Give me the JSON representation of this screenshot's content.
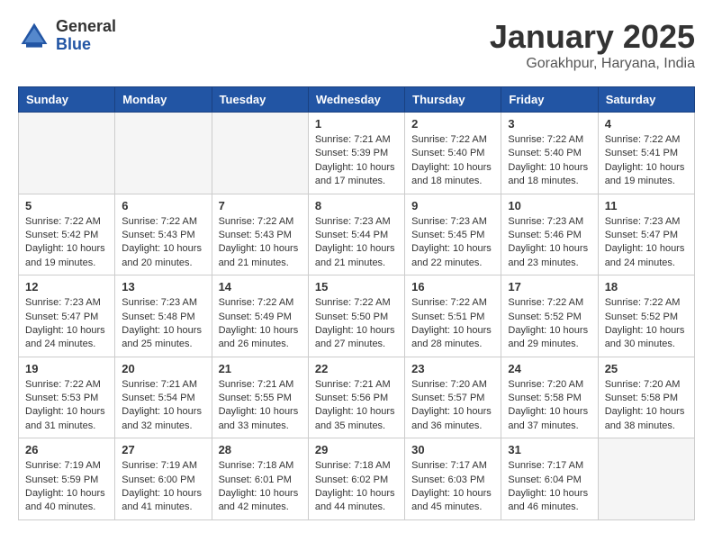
{
  "header": {
    "logo_general": "General",
    "logo_blue": "Blue",
    "title": "January 2025",
    "location": "Gorakhpur, Haryana, India"
  },
  "calendar": {
    "days_of_week": [
      "Sunday",
      "Monday",
      "Tuesday",
      "Wednesday",
      "Thursday",
      "Friday",
      "Saturday"
    ],
    "weeks": [
      [
        {
          "day": "",
          "info": ""
        },
        {
          "day": "",
          "info": ""
        },
        {
          "day": "",
          "info": ""
        },
        {
          "day": "1",
          "info": "Sunrise: 7:21 AM\nSunset: 5:39 PM\nDaylight: 10 hours\nand 17 minutes."
        },
        {
          "day": "2",
          "info": "Sunrise: 7:22 AM\nSunset: 5:40 PM\nDaylight: 10 hours\nand 18 minutes."
        },
        {
          "day": "3",
          "info": "Sunrise: 7:22 AM\nSunset: 5:40 PM\nDaylight: 10 hours\nand 18 minutes."
        },
        {
          "day": "4",
          "info": "Sunrise: 7:22 AM\nSunset: 5:41 PM\nDaylight: 10 hours\nand 19 minutes."
        }
      ],
      [
        {
          "day": "5",
          "info": "Sunrise: 7:22 AM\nSunset: 5:42 PM\nDaylight: 10 hours\nand 19 minutes."
        },
        {
          "day": "6",
          "info": "Sunrise: 7:22 AM\nSunset: 5:43 PM\nDaylight: 10 hours\nand 20 minutes."
        },
        {
          "day": "7",
          "info": "Sunrise: 7:22 AM\nSunset: 5:43 PM\nDaylight: 10 hours\nand 21 minutes."
        },
        {
          "day": "8",
          "info": "Sunrise: 7:23 AM\nSunset: 5:44 PM\nDaylight: 10 hours\nand 21 minutes."
        },
        {
          "day": "9",
          "info": "Sunrise: 7:23 AM\nSunset: 5:45 PM\nDaylight: 10 hours\nand 22 minutes."
        },
        {
          "day": "10",
          "info": "Sunrise: 7:23 AM\nSunset: 5:46 PM\nDaylight: 10 hours\nand 23 minutes."
        },
        {
          "day": "11",
          "info": "Sunrise: 7:23 AM\nSunset: 5:47 PM\nDaylight: 10 hours\nand 24 minutes."
        }
      ],
      [
        {
          "day": "12",
          "info": "Sunrise: 7:23 AM\nSunset: 5:47 PM\nDaylight: 10 hours\nand 24 minutes."
        },
        {
          "day": "13",
          "info": "Sunrise: 7:23 AM\nSunset: 5:48 PM\nDaylight: 10 hours\nand 25 minutes."
        },
        {
          "day": "14",
          "info": "Sunrise: 7:22 AM\nSunset: 5:49 PM\nDaylight: 10 hours\nand 26 minutes."
        },
        {
          "day": "15",
          "info": "Sunrise: 7:22 AM\nSunset: 5:50 PM\nDaylight: 10 hours\nand 27 minutes."
        },
        {
          "day": "16",
          "info": "Sunrise: 7:22 AM\nSunset: 5:51 PM\nDaylight: 10 hours\nand 28 minutes."
        },
        {
          "day": "17",
          "info": "Sunrise: 7:22 AM\nSunset: 5:52 PM\nDaylight: 10 hours\nand 29 minutes."
        },
        {
          "day": "18",
          "info": "Sunrise: 7:22 AM\nSunset: 5:52 PM\nDaylight: 10 hours\nand 30 minutes."
        }
      ],
      [
        {
          "day": "19",
          "info": "Sunrise: 7:22 AM\nSunset: 5:53 PM\nDaylight: 10 hours\nand 31 minutes."
        },
        {
          "day": "20",
          "info": "Sunrise: 7:21 AM\nSunset: 5:54 PM\nDaylight: 10 hours\nand 32 minutes."
        },
        {
          "day": "21",
          "info": "Sunrise: 7:21 AM\nSunset: 5:55 PM\nDaylight: 10 hours\nand 33 minutes."
        },
        {
          "day": "22",
          "info": "Sunrise: 7:21 AM\nSunset: 5:56 PM\nDaylight: 10 hours\nand 35 minutes."
        },
        {
          "day": "23",
          "info": "Sunrise: 7:20 AM\nSunset: 5:57 PM\nDaylight: 10 hours\nand 36 minutes."
        },
        {
          "day": "24",
          "info": "Sunrise: 7:20 AM\nSunset: 5:58 PM\nDaylight: 10 hours\nand 37 minutes."
        },
        {
          "day": "25",
          "info": "Sunrise: 7:20 AM\nSunset: 5:58 PM\nDaylight: 10 hours\nand 38 minutes."
        }
      ],
      [
        {
          "day": "26",
          "info": "Sunrise: 7:19 AM\nSunset: 5:59 PM\nDaylight: 10 hours\nand 40 minutes."
        },
        {
          "day": "27",
          "info": "Sunrise: 7:19 AM\nSunset: 6:00 PM\nDaylight: 10 hours\nand 41 minutes."
        },
        {
          "day": "28",
          "info": "Sunrise: 7:18 AM\nSunset: 6:01 PM\nDaylight: 10 hours\nand 42 minutes."
        },
        {
          "day": "29",
          "info": "Sunrise: 7:18 AM\nSunset: 6:02 PM\nDaylight: 10 hours\nand 44 minutes."
        },
        {
          "day": "30",
          "info": "Sunrise: 7:17 AM\nSunset: 6:03 PM\nDaylight: 10 hours\nand 45 minutes."
        },
        {
          "day": "31",
          "info": "Sunrise: 7:17 AM\nSunset: 6:04 PM\nDaylight: 10 hours\nand 46 minutes."
        },
        {
          "day": "",
          "info": ""
        }
      ]
    ]
  }
}
